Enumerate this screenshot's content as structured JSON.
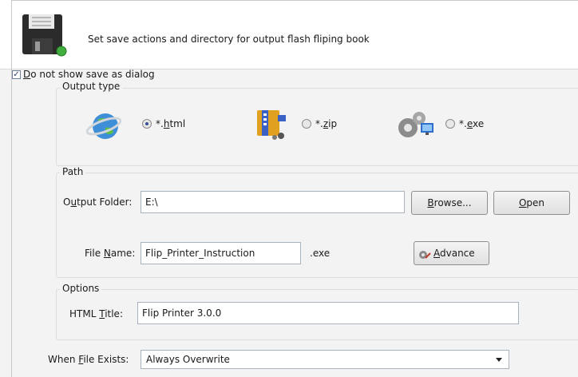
{
  "header": {
    "icon": "floppy-disk-icon",
    "text": "Set save actions and directory for output flash fliping book"
  },
  "dont_show": {
    "pre": "",
    "accel": "D",
    "rest": "o not show save as dialog",
    "checked": true
  },
  "output_type": {
    "label": "Output type",
    "options": [
      {
        "icon": "globe-icon",
        "pre": "*.",
        "accel": "h",
        "rest": "tml",
        "selected": true
      },
      {
        "icon": "zip-archive-icon",
        "pre": "*.",
        "accel": "z",
        "rest": "ip",
        "selected": false
      },
      {
        "icon": "gears-exe-icon",
        "pre": "*.",
        "accel": "e",
        "rest": "xe",
        "selected": false
      }
    ]
  },
  "path": {
    "label": "Path",
    "output_folder": {
      "pre": "O",
      "accel": "u",
      "rest": "tput Folder:",
      "value": "E:\\"
    },
    "browse": {
      "accel": "B",
      "rest": "rowse..."
    },
    "open": {
      "accel": "O",
      "rest": "pen"
    },
    "file_name": {
      "pre": "File ",
      "accel": "N",
      "rest": "ame:",
      "value": "Flip_Printer_Instruction"
    },
    "ext": ".exe",
    "advance": {
      "accel": "A",
      "rest": "dvance",
      "icon": "advance-icon"
    }
  },
  "options": {
    "label": "Options",
    "html_title": {
      "pre": "HTML ",
      "accel": "T",
      "rest": "itle:",
      "value": "Flip Printer 3.0.0"
    }
  },
  "when_exists": {
    "pre": "When ",
    "accel": "F",
    "rest": "ile Exists:",
    "value": "Always Overwrite"
  }
}
